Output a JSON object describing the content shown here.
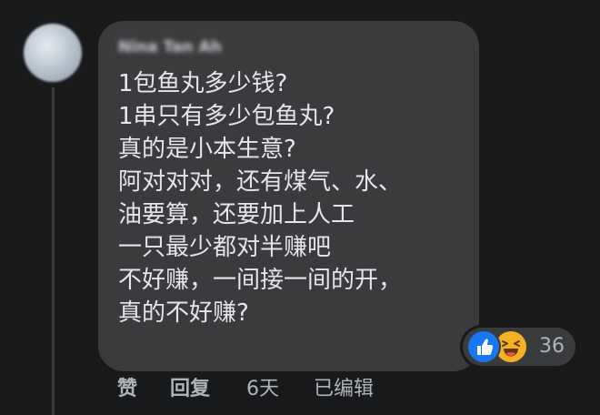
{
  "comment": {
    "author_name": "Nina Tan Ah",
    "lines": [
      "1包鱼丸多少钱?",
      "1串只有多少包鱼丸?",
      "真的是小本生意?",
      "阿对对对，还有煤气、水、",
      "油要算，还要加上人工",
      "一只最少都对半赚吧",
      "不好赚，一间接一间的开，",
      "真的不好赚?"
    ]
  },
  "reactions": {
    "icons": [
      "like-icon",
      "haha-icon"
    ],
    "count": "36",
    "colors": {
      "like": "#1877f2",
      "haha": "#f7b125"
    }
  },
  "actions": {
    "like_label": "赞",
    "reply_label": "回复",
    "timestamp": "6天",
    "edited_label": "已编辑"
  },
  "theme": {
    "background": "#18191a",
    "bubble": "#3a3b3c",
    "text": "#e4e6eb",
    "muted": "#b0b3b8"
  }
}
